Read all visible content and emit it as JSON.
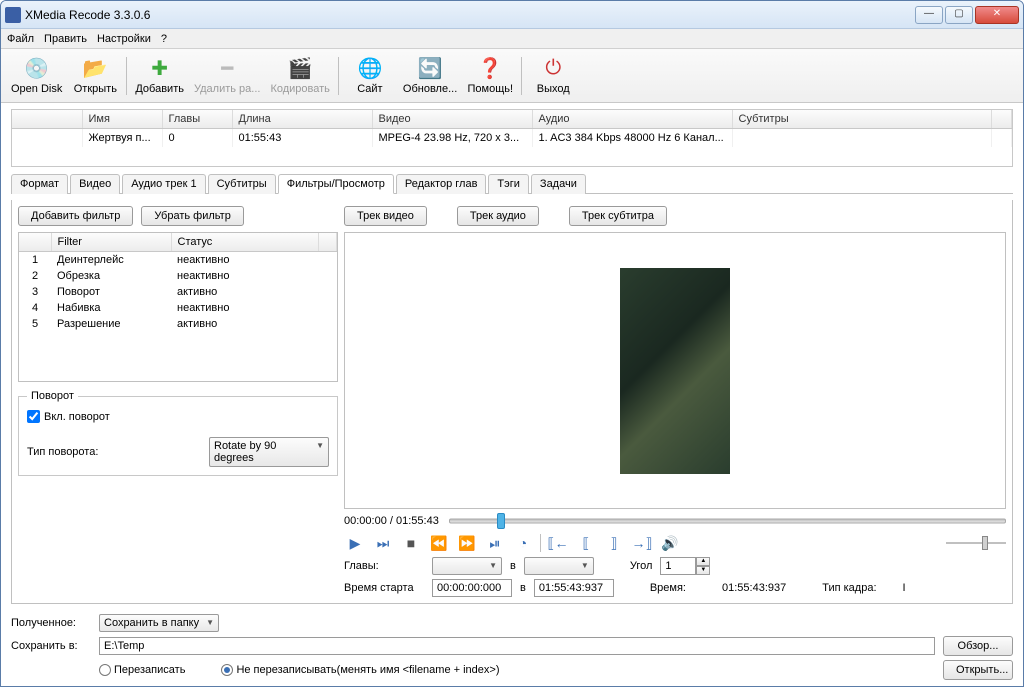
{
  "window": {
    "title": "XMedia Recode 3.3.0.6"
  },
  "menu": {
    "file": "Файл",
    "edit": "Править",
    "settings": "Настройки",
    "help": "?"
  },
  "toolbar": {
    "opendisk": "Open Disk",
    "open": "Открыть",
    "add": "Добавить",
    "remove": "Удалить ра...",
    "encode": "Кодировать",
    "site": "Сайт",
    "update": "Обновле...",
    "helpbtn": "Помощь!",
    "exit": "Выход"
  },
  "filecols": {
    "name": "Имя",
    "chapters": "Главы",
    "length": "Длина",
    "video": "Видео",
    "audio": "Аудио",
    "subs": "Субтитры"
  },
  "filerow": {
    "name": "Жертвуя п...",
    "chapters": "0",
    "length": "01:55:43",
    "video": "MPEG-4 23.98 Hz, 720 x 3...",
    "audio": "1. AC3 384 Kbps 48000 Hz 6 Канал...",
    "subs": ""
  },
  "tabs": {
    "format": "Формат",
    "video": "Видео",
    "audio": "Аудио трек 1",
    "subs": "Субтитры",
    "filters": "Фильтры/Просмотр",
    "chapters": "Редактор глав",
    "tags": "Тэги",
    "jobs": "Задачи"
  },
  "filters": {
    "add": "Добавить фильтр",
    "remove": "Убрать фильтр",
    "col_filter": "Filter",
    "col_status": "Статус",
    "rows": [
      {
        "n": "1",
        "name": "Деинтерлейс",
        "status": "неактивно"
      },
      {
        "n": "2",
        "name": "Обрезка",
        "status": "неактивно"
      },
      {
        "n": "3",
        "name": "Поворот",
        "status": "активно"
      },
      {
        "n": "4",
        "name": "Набивка",
        "status": "неактивно"
      },
      {
        "n": "5",
        "name": "Разрешение",
        "status": "активно"
      }
    ],
    "rotate_group": "Поворот",
    "enable_rotate": "Вкл. поворот",
    "rotate_type_label": "Тип поворота:",
    "rotate_type": "Rotate by 90 degrees"
  },
  "preview": {
    "track_video": "Трек видео",
    "track_audio": "Трек аудио",
    "track_sub": "Трек субтитра",
    "time": "00:00:00 / 01:55:43",
    "chapters_label": "Главы:",
    "in_label": "в",
    "angle_label": "Угол",
    "angle_value": "1",
    "start_label": "Время старта",
    "start_value": "00:00:00:000",
    "end_value": "01:55:43:937",
    "duration_label": "Время:",
    "duration_value": "01:55:43:937",
    "frametype_label": "Тип кадра:",
    "frametype_value": "I"
  },
  "output": {
    "result_label": "Полученное:",
    "result_value": "Сохранить в папку",
    "save_label": "Сохранить в:",
    "path": "E:\\Temp",
    "browse": "Обзор...",
    "openbtn": "Открыть...",
    "overwrite": "Перезаписать",
    "no_overwrite": "Не перезаписывать(менять имя <filename + index>)"
  }
}
